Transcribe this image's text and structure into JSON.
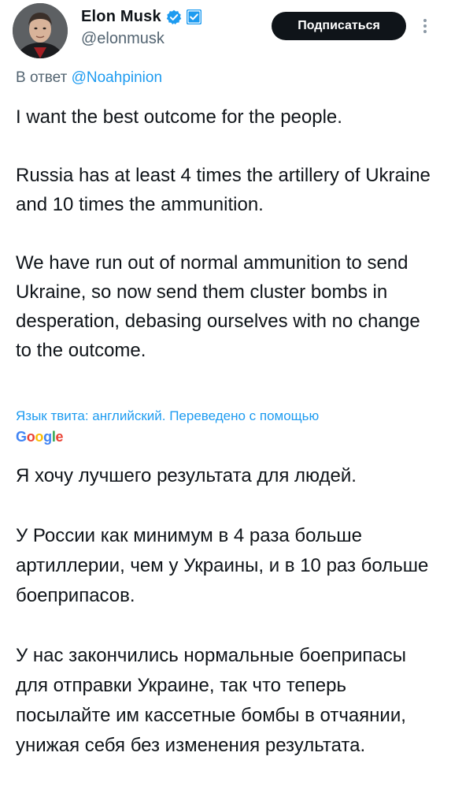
{
  "author": {
    "name": "Elon Musk",
    "handle": "@elonmusk",
    "verified_color": "#1d9bf0"
  },
  "header": {
    "subscribe_label": "Подписаться"
  },
  "reply": {
    "prefix": "В ответ ",
    "mention": "@Noahpinion"
  },
  "tweet": {
    "paragraphs": [
      "I want the best outcome for the people.",
      "Russia has at least 4 times the artillery of Ukraine and 10 times the ammunition.",
      "We have run out of normal ammunition to send Ukraine, so now send them cluster bombs in desperation, debasing ourselves with no change to the outcome."
    ]
  },
  "translation": {
    "note": "Язык твита: английский. Переведено с помощью",
    "provider": "Google",
    "paragraphs": [
      "Я хочу лучшего результата для людей.",
      "У России как минимум в 4 раза больше артиллерии, чем у Украины, и в 10 раз больше боеприпасов.",
      "У нас закончились нормальные боеприпасы для отправки Украине, так что теперь посылайте им кассетные бомбы в отчаянии, унижая себя без изменения результата."
    ]
  }
}
